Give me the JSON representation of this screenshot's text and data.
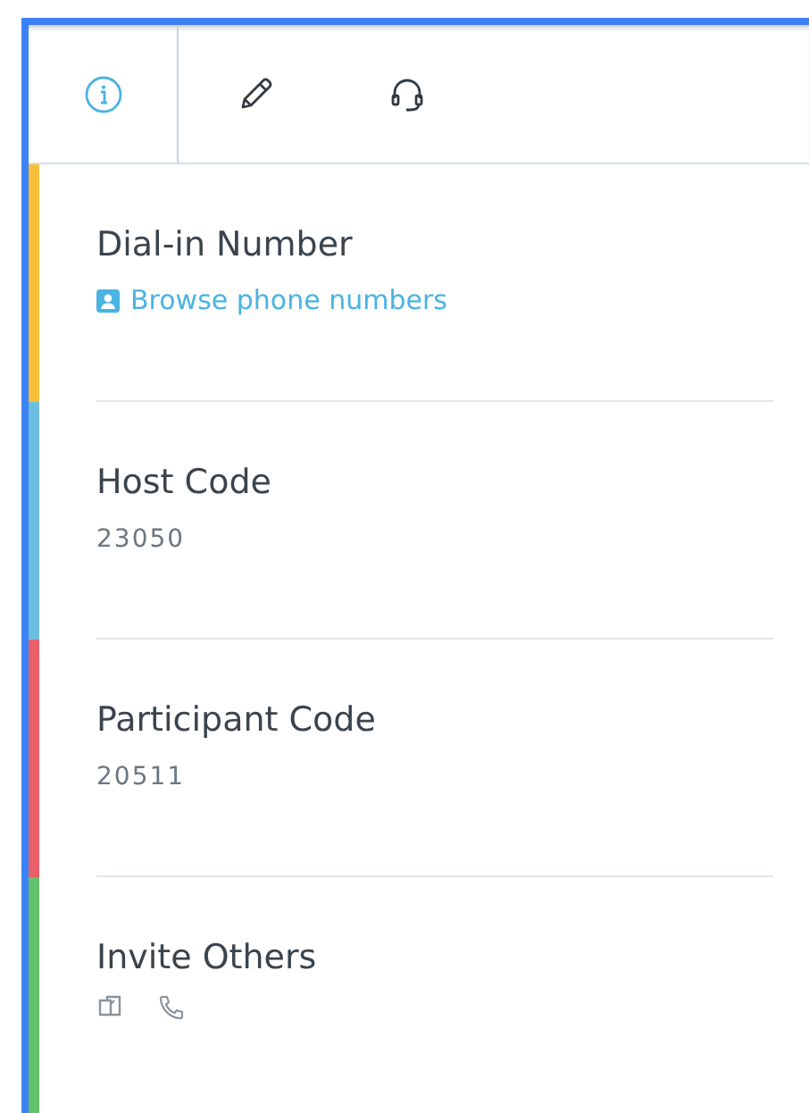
{
  "tabs": [
    {
      "selected": true
    },
    {
      "selected": false
    },
    {
      "selected": false
    }
  ],
  "sections": [
    {
      "title": "Dial-in Number",
      "color": "#f8bf3a",
      "kind": "link",
      "link": "Browse phone numbers"
    },
    {
      "title": "Host Code",
      "color": "#6cbde0",
      "kind": "value",
      "value": "23050"
    },
    {
      "title": "Participant Code",
      "color": "#ea6068",
      "kind": "value",
      "value": "20511"
    },
    {
      "title": "Invite Others",
      "color": "#63c06c",
      "kind": "actions"
    }
  ]
}
